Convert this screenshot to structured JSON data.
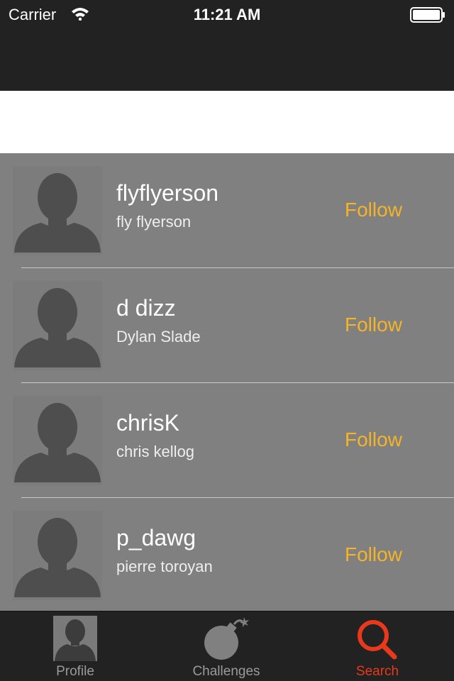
{
  "status_bar": {
    "carrier": "Carrier",
    "time": "11:21 AM"
  },
  "search": {
    "value": "",
    "placeholder": ""
  },
  "results": [
    {
      "username": "flyflyerson",
      "full_name": "fly flyerson",
      "action": "Follow"
    },
    {
      "username": "d dizz",
      "full_name": "Dylan Slade",
      "action": "Follow"
    },
    {
      "username": "chrisK",
      "full_name": "chris kellog",
      "action": "Follow"
    },
    {
      "username": "p_dawg",
      "full_name": "pierre toroyan",
      "action": "Follow"
    }
  ],
  "tab_bar": {
    "tabs": [
      {
        "label": "Profile",
        "icon": "person-icon",
        "active": false
      },
      {
        "label": "Challenges",
        "icon": "bomb-icon",
        "active": false
      },
      {
        "label": "Search",
        "icon": "search-icon",
        "active": true
      }
    ]
  },
  "colors": {
    "accent_follow": "#f5b428",
    "active_tab": "#e8391c",
    "bar_background": "#222222",
    "list_background": "#808080"
  }
}
